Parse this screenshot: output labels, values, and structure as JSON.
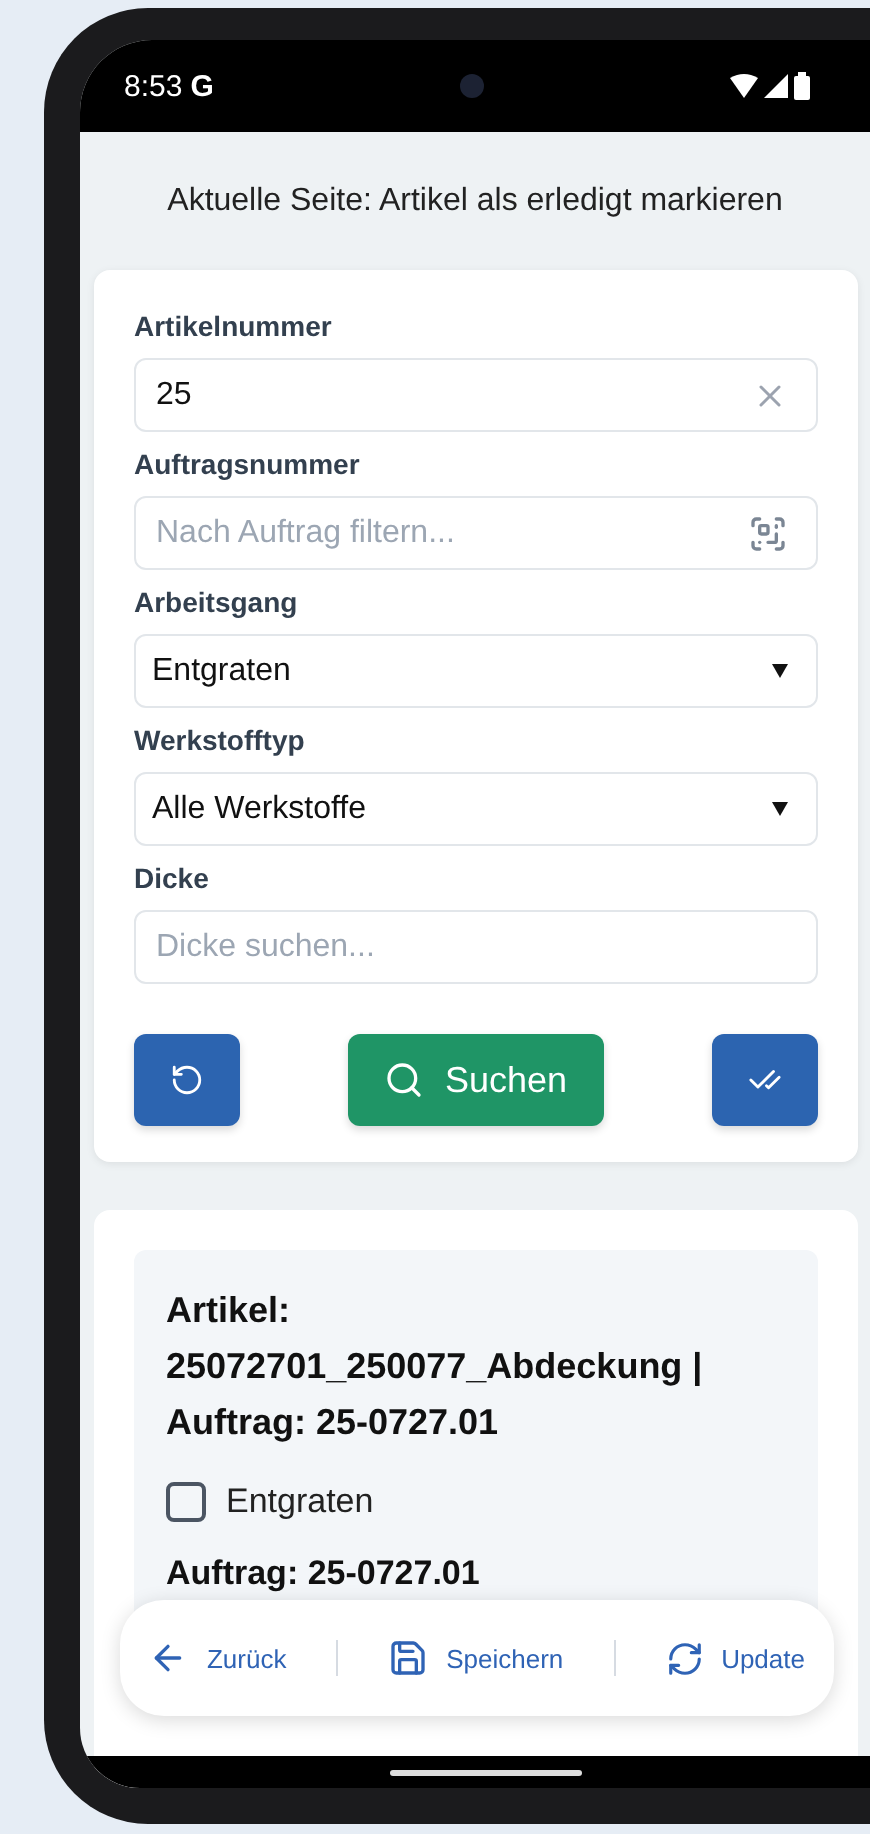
{
  "status_bar": {
    "time": "8:53",
    "carrier_mark": "G"
  },
  "page_title": "Aktuelle Seite: Artikel als erledigt markieren",
  "filters": [
    {
      "kind": "text",
      "label": "Artikelnummer",
      "value": "25",
      "clearable": true
    },
    {
      "kind": "scan",
      "label": "Auftragsnummer",
      "placeholder": "Nach Auftrag filtern..."
    },
    {
      "kind": "select",
      "label": "Arbeitsgang",
      "value": "Entgraten"
    },
    {
      "kind": "select",
      "label": "Werkstofftyp",
      "value": "Alle Werkstoffe"
    },
    {
      "kind": "text",
      "label": "Dicke",
      "placeholder": "Dicke suchen...",
      "clearable": false
    }
  ],
  "actions": [
    {
      "kind": "reset"
    },
    {
      "kind": "search",
      "label": "Suchen"
    },
    {
      "kind": "mark_done"
    }
  ],
  "results": [
    {
      "title": "Artikel: 25072701_250077_Abdeckung | Auftrag: 25-0727.01",
      "steps": [
        {
          "label": "Entgraten",
          "checked": false
        }
      ]
    }
  ],
  "next_result_peek": "Auftrag: 25-0727.01",
  "bottom_nav": [
    {
      "kind": "back",
      "label": "Zurück"
    },
    {
      "kind": "save",
      "label": "Speichern"
    },
    {
      "kind": "update",
      "label": "Update"
    }
  ]
}
